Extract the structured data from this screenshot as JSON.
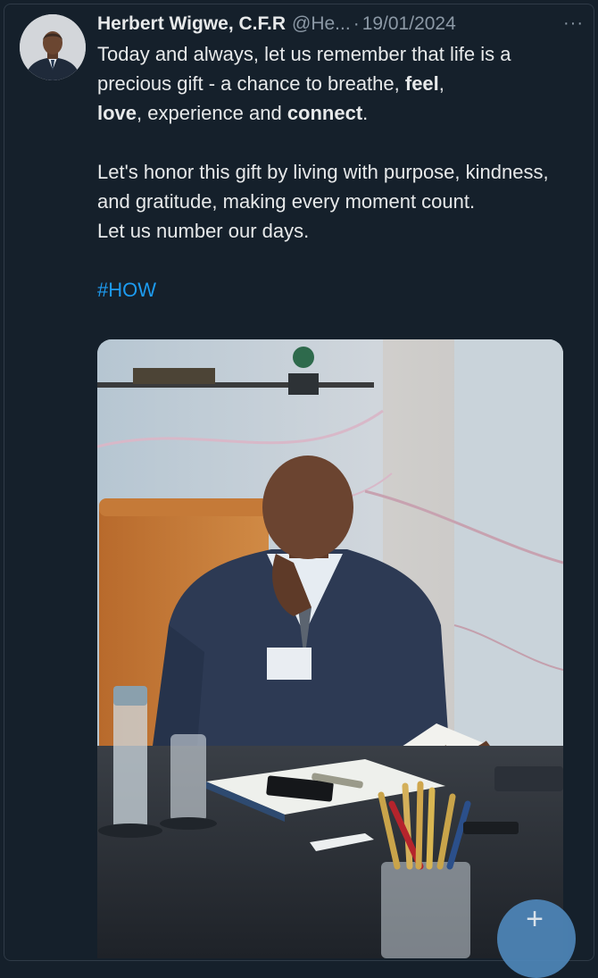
{
  "tweet": {
    "author_name": "Herbert Wigwe, C.F.R",
    "author_handle": "@He...",
    "separator": "·",
    "date": "19/01/2024",
    "more_label": "···",
    "paragraph1_part1": "Today and always, let us remember that life is a precious gift - a chance to breathe, ",
    "bold_feel": "feel",
    "comma": ",",
    "bold_love": "love",
    "paragraph1_part2": ", experience and ",
    "bold_connect": "connect",
    "period": ".",
    "paragraph2_line1": "Let's honor this gift by living with purpose, kindness, and gratitude, making every moment count.",
    "paragraph2_line2": "Let us number our days.",
    "hashtag": "#HOW"
  },
  "fab": {
    "label": "+"
  },
  "colors": {
    "background": "#15202b",
    "text": "#e7e9ea",
    "secondary": "#8b98a5",
    "link": "#1d9bf0",
    "fab": "#4e86b9"
  }
}
